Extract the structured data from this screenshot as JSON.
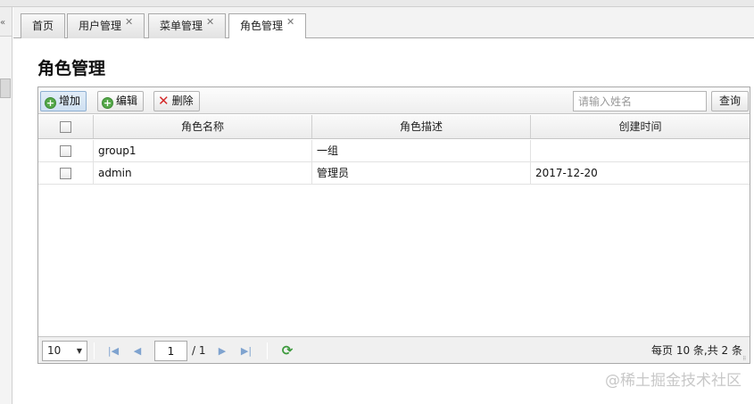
{
  "tabs": [
    {
      "label": "首页",
      "closable": false,
      "active": false
    },
    {
      "label": "用户管理",
      "closable": true,
      "active": false
    },
    {
      "label": "菜单管理",
      "closable": true,
      "active": false
    },
    {
      "label": "角色管理",
      "closable": true,
      "active": true
    }
  ],
  "close_glyph": "✕",
  "page": {
    "title": "角色管理"
  },
  "toolbar": {
    "add_label": "增加",
    "edit_label": "编辑",
    "delete_label": "删除",
    "search_placeholder": "请输入姓名",
    "search_value": "",
    "search_button": "查询"
  },
  "table": {
    "columns": [
      "角色名称",
      "角色描述",
      "创建时间"
    ],
    "rows": [
      {
        "name": "group1",
        "description": "一组",
        "created": ""
      },
      {
        "name": "admin",
        "description": "管理员",
        "created": "2017-12-20"
      }
    ]
  },
  "pager": {
    "page_size": "10",
    "current_page": "1",
    "total_pages": "/ 1",
    "summary": "每页 10 条,共 2 条"
  },
  "watermark": "@稀土掘金技术社区",
  "icons": {
    "add": "plus-circle-icon",
    "edit": "plus-circle-icon",
    "delete": "red-x-icon",
    "first": "first-page-icon",
    "prev": "prev-page-icon",
    "next": "next-page-icon",
    "last": "last-page-icon",
    "refresh": "refresh-icon"
  },
  "colors": {
    "add_icon": "#55a84a",
    "delete_icon": "#d42a2a",
    "pager_arrows": "#7fa3cf",
    "refresh_icon": "#3d9a3d"
  }
}
